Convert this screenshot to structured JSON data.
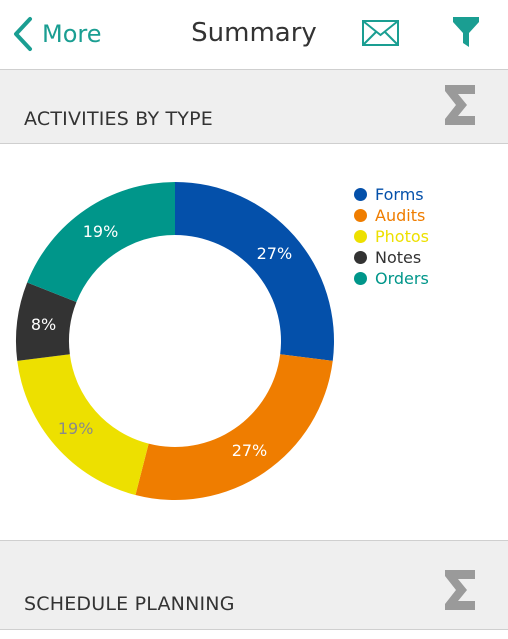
{
  "navbar": {
    "back_label": "More",
    "title": "Summary",
    "accent_color": "#1a9e92"
  },
  "icons": {
    "back": "chevron-left-icon",
    "mail": "envelope-icon",
    "filter": "funnel-icon",
    "sigma": "sigma-icon"
  },
  "sections": [
    {
      "title": "ACTIVITIES BY TYPE"
    },
    {
      "title": "SCHEDULE PLANNING"
    }
  ],
  "chart_data": {
    "type": "pie",
    "subtype": "donut",
    "title": "",
    "categories": [
      "Forms",
      "Audits",
      "Photos",
      "Notes",
      "Orders"
    ],
    "values": [
      27,
      27,
      19,
      8,
      19
    ],
    "labels": [
      "27%",
      "27%",
      "19%",
      "8%",
      "19%"
    ],
    "colors": [
      "#0450aa",
      "#ef7d00",
      "#ede000",
      "#333333",
      "#00968a"
    ],
    "legend": "right",
    "start": "top",
    "direction": "clockwise"
  }
}
